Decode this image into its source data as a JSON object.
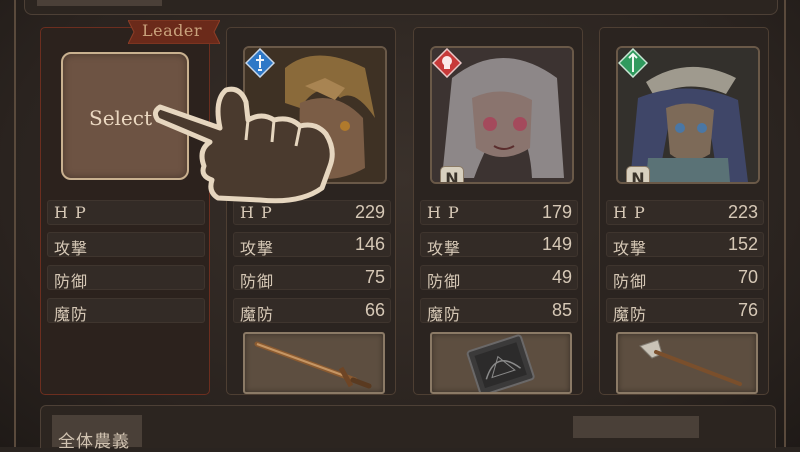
{
  "leader_tag": "Leader",
  "select_label": "Select",
  "stat_labels": [
    "H P",
    "攻撃",
    "防御",
    "魔防"
  ],
  "bottom_label": "全体農義",
  "party": [
    {
      "slot": "leader",
      "stats": [
        "",
        "",
        "",
        ""
      ]
    },
    {
      "slot": "member-1",
      "element_icon": "blue-sword-element-icon",
      "element_color": "#2e78c7",
      "rarity": "",
      "stats": [
        "229",
        "146",
        "75",
        "66"
      ],
      "weapon": "sword"
    },
    {
      "slot": "member-2",
      "element_icon": "red-skull-element-icon",
      "element_color": "#c73a3a",
      "rarity": "N",
      "stats": [
        "179",
        "149",
        "49",
        "85"
      ],
      "weapon": "tome"
    },
    {
      "slot": "member-3",
      "element_icon": "green-spear-element-icon",
      "element_color": "#2f9a5e",
      "rarity": "N",
      "stats": [
        "223",
        "152",
        "70",
        "76"
      ],
      "weapon": "spear"
    }
  ]
}
